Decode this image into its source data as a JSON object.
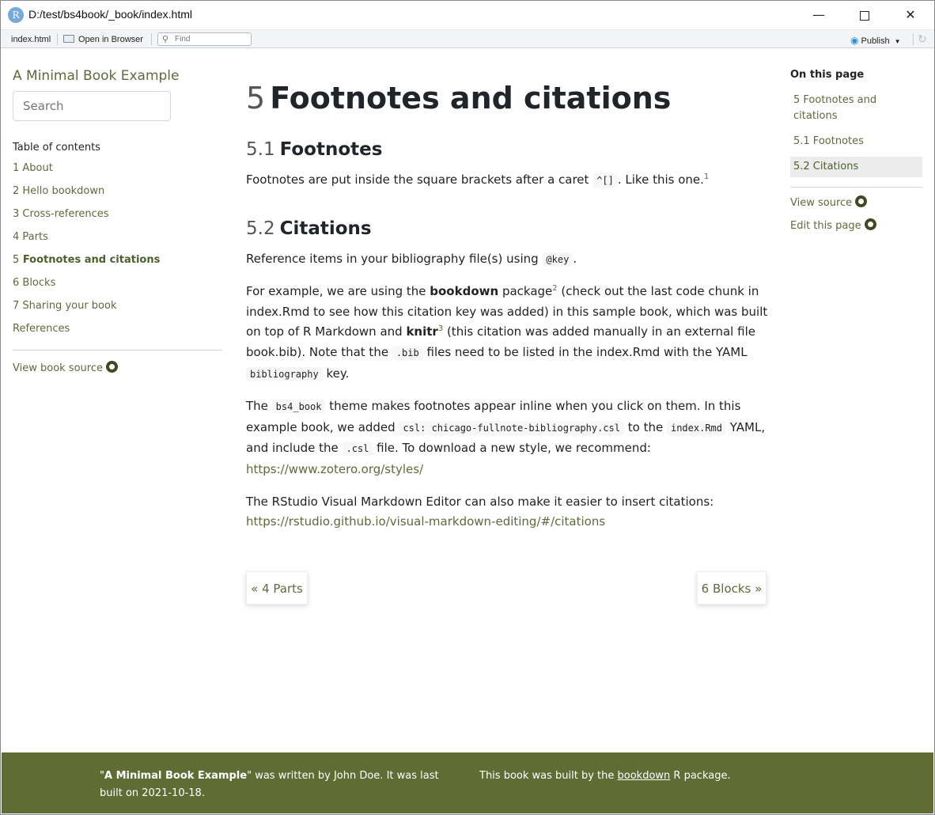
{
  "window": {
    "title": "D:/test/bs4book/_book/index.html",
    "app_icon_letter": "R",
    "minimize_glyph": "—",
    "close_glyph": "✕"
  },
  "toolbar": {
    "file_tab": "index.html",
    "open_in_browser": "Open in Browser",
    "find_placeholder": "Find",
    "publish_label": "Publish"
  },
  "sidebar": {
    "brand": "A Minimal Book Example",
    "search_placeholder": "Search",
    "toc_title": "Table of contents",
    "items": [
      {
        "label": "1 About"
      },
      {
        "label": "2 Hello bookdown"
      },
      {
        "label": "3 Cross-references"
      },
      {
        "label": "4 Parts"
      },
      {
        "label_num": "5",
        "label_text": "Footnotes and citations"
      },
      {
        "label": "6 Blocks"
      },
      {
        "label": "7 Sharing your book"
      },
      {
        "label": "References"
      }
    ],
    "view_source": "View book source"
  },
  "main": {
    "h1_num": "5",
    "h1_text": "Footnotes and citations",
    "s1_num": "5.1",
    "s1_text": "Footnotes",
    "p1_a": "Footnotes are put inside the square brackets after a caret ",
    "p1_code": "^[]",
    "p1_b": ". Like this one.",
    "p1_sup": "1",
    "s2_num": "5.2",
    "s2_text": "Citations",
    "p2_a": "Reference items in your bibliography file(s) using ",
    "p2_code": "@key",
    "p2_b": ".",
    "p3_a": "For example, we are using the ",
    "p3_bookdown": "bookdown",
    "p3_b": " package",
    "p3_sup2": "2",
    "p3_c": " (check out the last code chunk in index.Rmd to see how this citation key was added) in this sample book, which was built on top of R Markdown and ",
    "p3_knitr": "knitr",
    "p3_sup3": "3",
    "p3_d": " (this citation was added manually in an external file book.bib). Note that the ",
    "p3_code_bib": ".bib",
    "p3_e": " files need to be listed in the index.Rmd with the YAML ",
    "p3_code_bibliography": "bibliography",
    "p3_f": " key.",
    "p4_a": "The ",
    "p4_code_theme": "bs4_book",
    "p4_b": " theme makes footnotes appear inline when you click on them. In this example book, we added ",
    "p4_code_csl": "csl: chicago-fullnote-bibliography.csl",
    "p4_c": " to the ",
    "p4_code_index": "index.Rmd",
    "p4_d": " YAML, and include the ",
    "p4_code_ext": ".csl",
    "p4_e": " file. To download a new style, we recommend: ",
    "p4_link": "https://www.zotero.org/styles/",
    "p5_a": "The RStudio Visual Markdown Editor can also make it easier to insert citations: ",
    "p5_link": "https://rstudio.github.io/visual-markdown-editing/#/citations",
    "prev": "« 4 Parts",
    "next": "6 Blocks »"
  },
  "on_this_page": {
    "title": "On this page",
    "items": [
      {
        "label": "5 Footnotes and citations"
      },
      {
        "label": "5.1 Footnotes"
      },
      {
        "label": "5.2 Citations"
      }
    ],
    "view_source": "View source",
    "edit_page": "Edit this page"
  },
  "footer": {
    "left_quote_open": "\"",
    "left_title": "A Minimal Book Example",
    "left_rest": "\" was written by John Doe. It was last built on 2021-10-18.",
    "right_a": "This book was built by the ",
    "right_link": "bookdown",
    "right_b": " R package."
  }
}
